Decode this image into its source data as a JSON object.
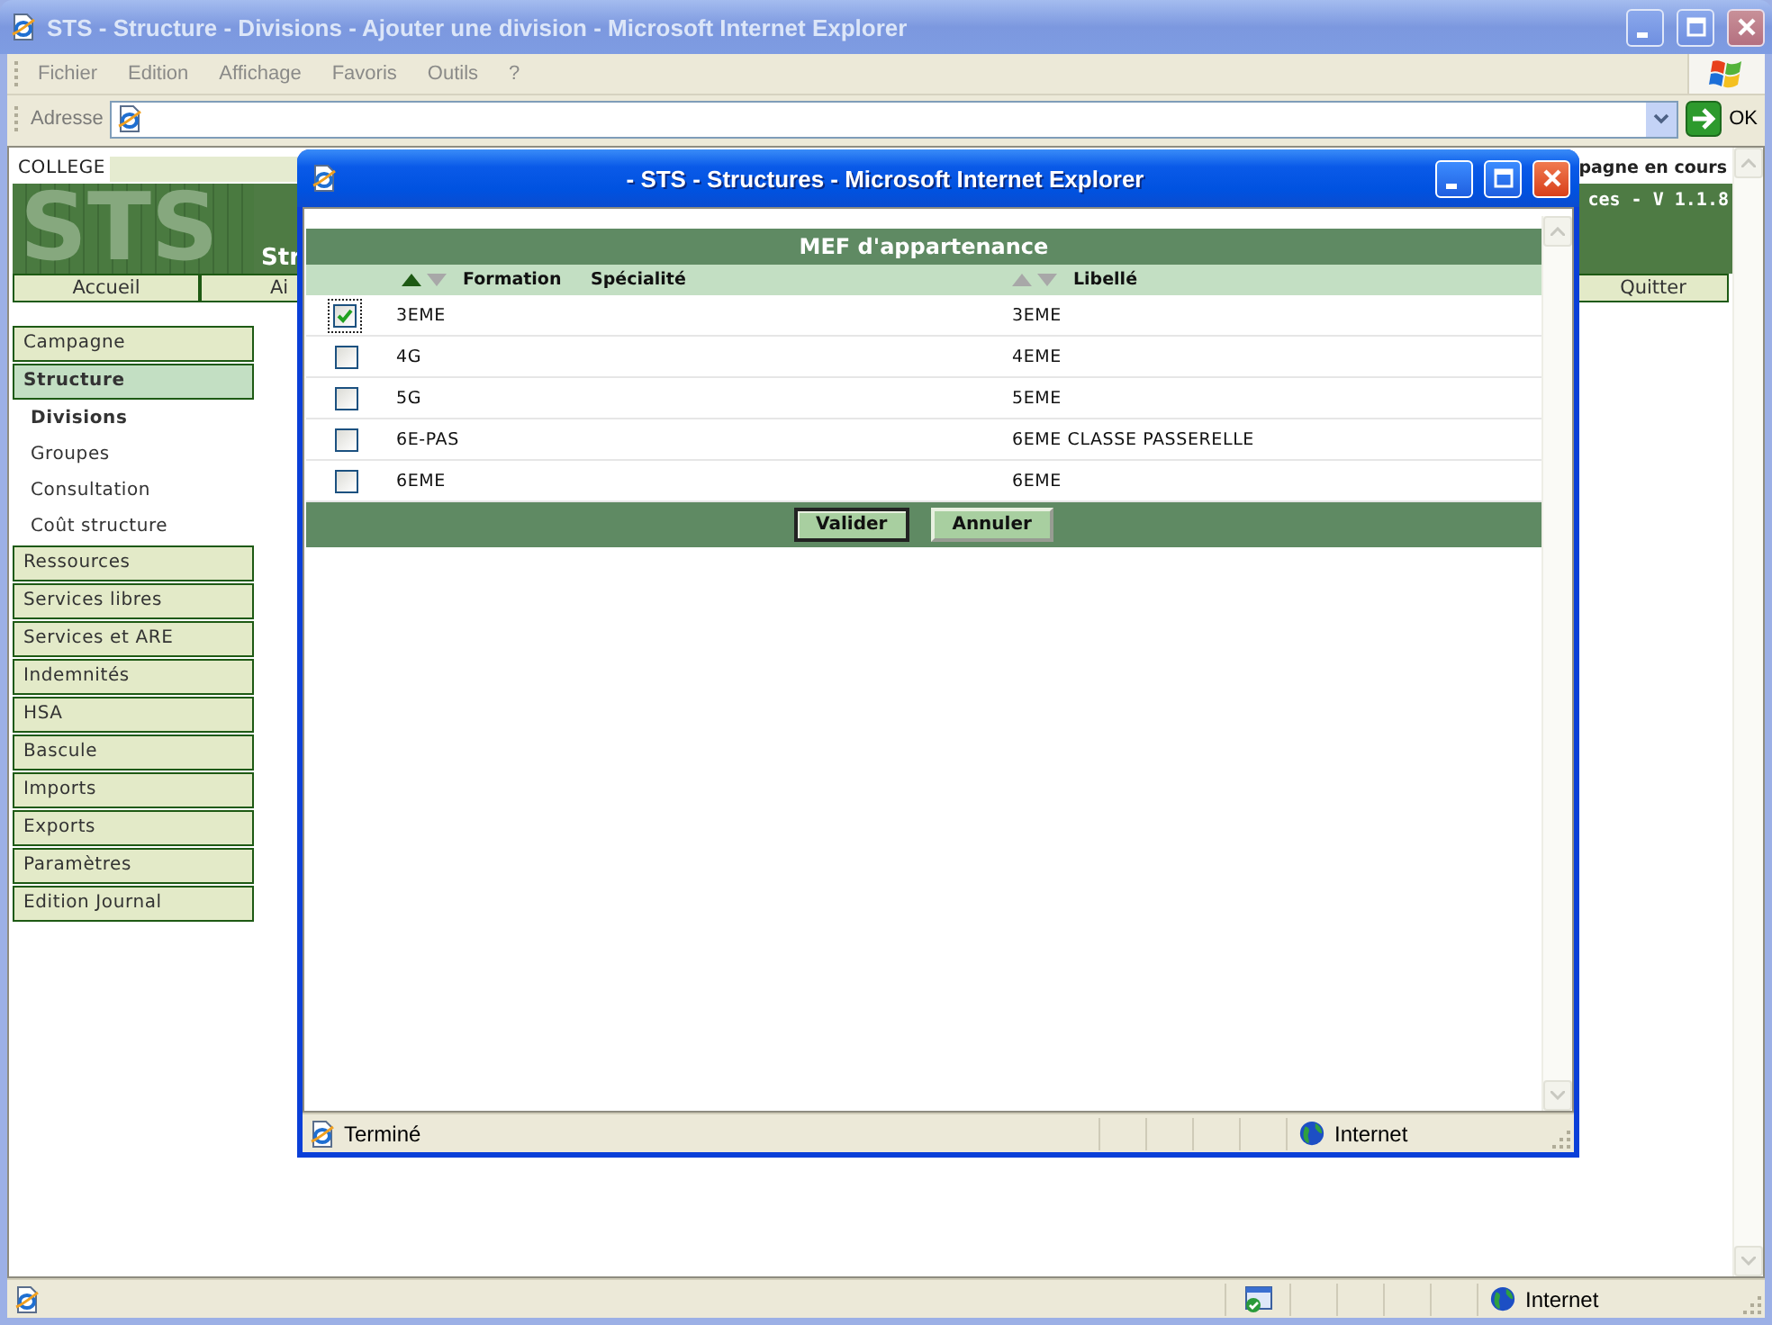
{
  "window": {
    "title": "STS - Structure - Divisions - Ajouter une division - Microsoft Internet Explorer"
  },
  "menu": [
    {
      "label": "Fichier"
    },
    {
      "label": "Edition"
    },
    {
      "label": "Affichage"
    },
    {
      "label": "Favoris"
    },
    {
      "label": "Outils"
    },
    {
      "label": "?"
    }
  ],
  "address_bar": {
    "label": "Adresse",
    "go_button": "OK"
  },
  "page": {
    "college_label": "COLLEGE",
    "campaign_status": "pagne en cours",
    "logo": "STS",
    "subtitle": "Str",
    "version": "ces - V 1.1.8",
    "nav": [
      {
        "label": "Accueil"
      },
      {
        "label": "Ai"
      },
      {
        "label": "Quitter"
      }
    ],
    "sidebar": [
      {
        "label": "Campagne",
        "selected": false
      },
      {
        "label": "Structure",
        "selected": true,
        "children": [
          {
            "label": "Divisions",
            "selected": true
          },
          {
            "label": "Groupes",
            "selected": false
          },
          {
            "label": "Consultation",
            "selected": false
          },
          {
            "label": "Coût structure",
            "selected": false
          }
        ]
      },
      {
        "label": "Ressources",
        "selected": false
      },
      {
        "label": "Services libres",
        "selected": false
      },
      {
        "label": "Services et ARE",
        "selected": false
      },
      {
        "label": "Indemnités",
        "selected": false
      },
      {
        "label": "HSA",
        "selected": false
      },
      {
        "label": "Bascule",
        "selected": false
      },
      {
        "label": "Imports",
        "selected": false
      },
      {
        "label": "Exports",
        "selected": false
      },
      {
        "label": "Paramètres",
        "selected": false
      },
      {
        "label": "Edition Journal",
        "selected": false
      }
    ]
  },
  "popup": {
    "title": "- STS - Structures - Microsoft Internet Explorer",
    "heading": "MEF d'appartenance",
    "columns": [
      {
        "label": "Formation",
        "sorted": true
      },
      {
        "label": "Spécialité"
      },
      {
        "label": "Libellé",
        "sorted": false
      }
    ],
    "rows": [
      {
        "checked": true,
        "formation": "3EME",
        "libelle": "3EME"
      },
      {
        "checked": false,
        "formation": "4G",
        "libelle": "4EME"
      },
      {
        "checked": false,
        "formation": "5G",
        "libelle": "5EME"
      },
      {
        "checked": false,
        "formation": "6E-PAS",
        "libelle": "6EME CLASSE PASSERELLE"
      },
      {
        "checked": false,
        "formation": "6EME",
        "libelle": "6EME"
      }
    ],
    "buttons": [
      {
        "label": "Valider",
        "default": true
      },
      {
        "label": "Annuler",
        "default": false
      }
    ],
    "status": "Terminé",
    "zone": "Internet"
  },
  "status_bar": {
    "zone": "Internet"
  }
}
